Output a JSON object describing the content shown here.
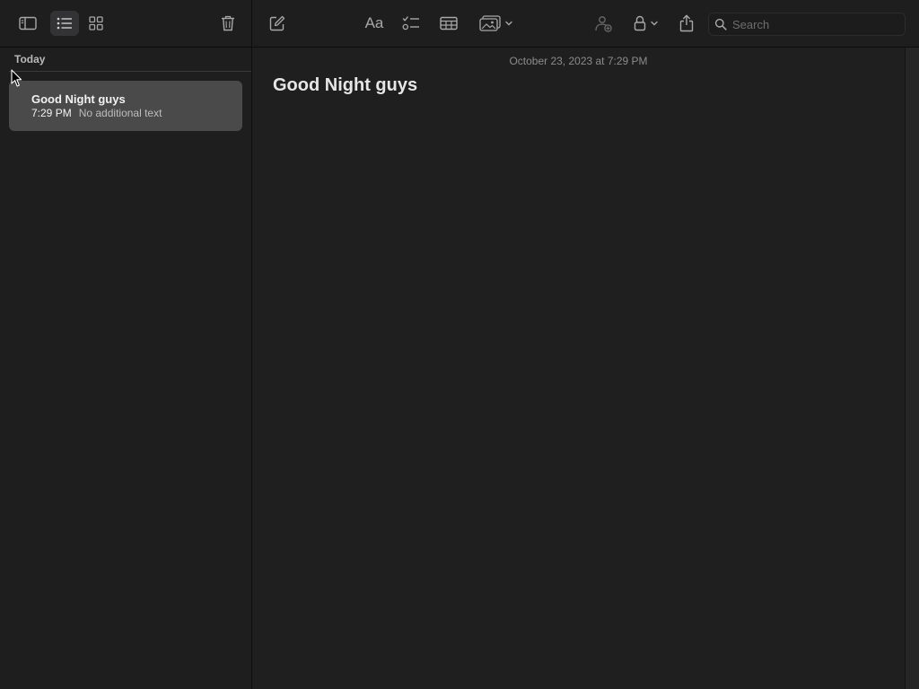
{
  "toolbar": {
    "sidebar_icon": "sidebar-icon",
    "list_view_icon": "list-view-icon",
    "gallery_view_icon": "gallery-view-icon",
    "delete_icon": "trash-icon",
    "compose_icon": "compose-icon",
    "format_label": "Aa",
    "checklist_icon": "checklist-icon",
    "table_icon": "table-icon",
    "media_icon": "photo-icon",
    "collaborate_icon": "collaborate-icon",
    "lock_icon": "lock-icon",
    "share_icon": "share-icon",
    "search_placeholder": "Search",
    "search_value": ""
  },
  "list": {
    "section_header": "Today",
    "notes": [
      {
        "title": "Good Night guys",
        "time": "7:29 PM",
        "preview": "No additional text"
      }
    ]
  },
  "editor": {
    "date": "October 23, 2023 at 7:29 PM",
    "title": "Good Night guys"
  },
  "colors": {
    "background": "#1e1e1e",
    "selected_note": "#4a4a4a",
    "icon": "#a8a8a8"
  }
}
